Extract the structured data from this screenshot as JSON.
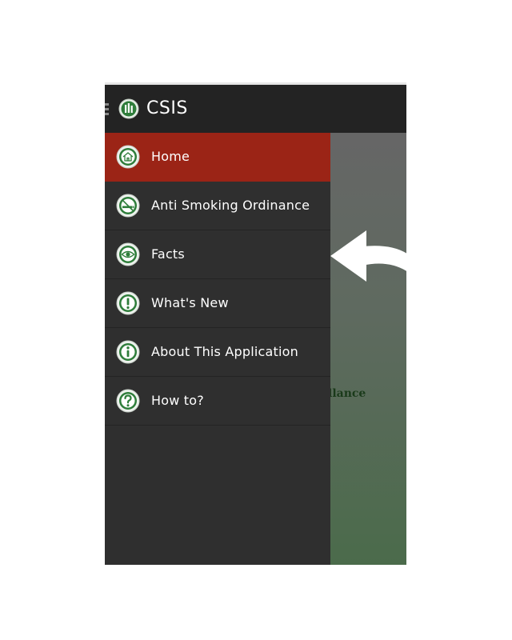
{
  "app": {
    "title": "CSIS"
  },
  "menu": {
    "items": [
      {
        "label": "Home",
        "icon": "home-icon",
        "active": true
      },
      {
        "label": "Anti Smoking Ordinance",
        "icon": "no-smoking-icon"
      },
      {
        "label": "Facts",
        "icon": "eye-icon"
      },
      {
        "label": "What's New",
        "icon": "exclamation-icon"
      },
      {
        "label": "About This Application",
        "icon": "info-icon"
      },
      {
        "label": "How to?",
        "icon": "question-icon"
      }
    ]
  },
  "content": {
    "partial_text": "llance"
  },
  "colors": {
    "active": "#9b2416",
    "actionbar": "#232323",
    "drawer": "#2f2f2f",
    "icon_green": "#2e7d3a"
  }
}
